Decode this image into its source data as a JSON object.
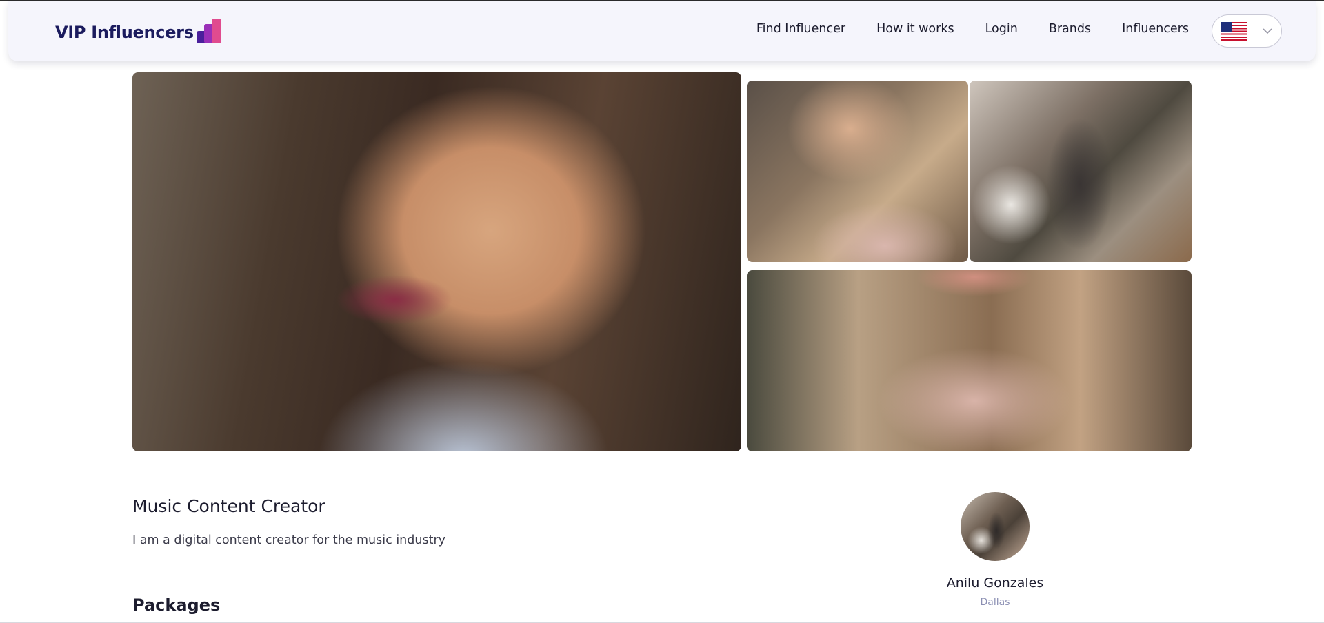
{
  "header": {
    "logo_text": "VIP Influencers",
    "nav": [
      {
        "label": "Find Influencer"
      },
      {
        "label": "How it works"
      },
      {
        "label": "Login"
      },
      {
        "label": "Brands"
      },
      {
        "label": "Influencers"
      }
    ],
    "language_flag_icon": "us-flag-icon"
  },
  "gallery": {
    "photos": [
      "photo-main",
      "photo-top-left",
      "photo-top-right",
      "photo-bottom"
    ]
  },
  "profile": {
    "title": "Music Content Creator",
    "description": "I am a digital content creator for the music industry",
    "packages_heading": "Packages",
    "name": "Anilu Gonzales",
    "city": "Dallas"
  },
  "colors": {
    "brand_navy": "#1b1b5e",
    "logo_purple": "#4a1f9c",
    "logo_violet": "#9a2fb8",
    "logo_pink": "#e04b8f",
    "header_bg": "#f5f5fc",
    "city_text": "#8b8fb3"
  }
}
